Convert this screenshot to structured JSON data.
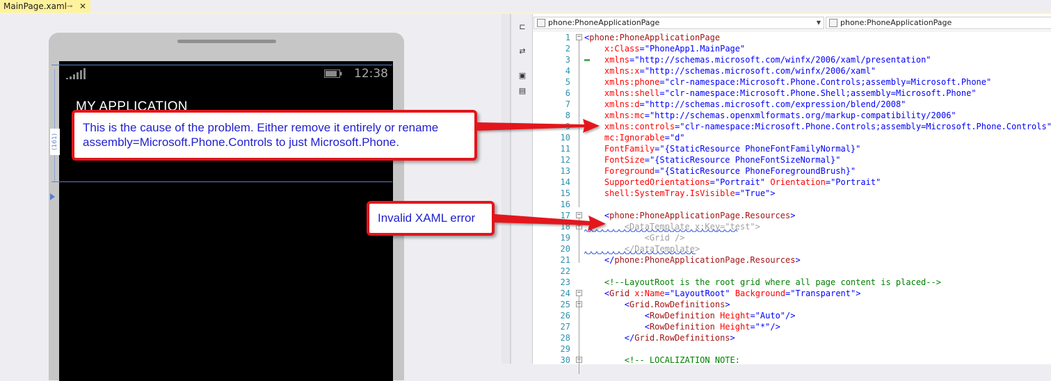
{
  "tab": {
    "title": "MainPage.xaml",
    "pin_icon": "pin-icon",
    "close_glyph": "✕"
  },
  "phone": {
    "status_time": "12:38",
    "app_title": "MY APPLICATION",
    "guide_label": "(161)"
  },
  "editor": {
    "nav_left": "phone:PhoneApplicationPage",
    "nav_right": "phone:PhoneApplicationPage",
    "lines": [
      {
        "n": "1",
        "fold": "minus",
        "html": "<span class='c-bracket'>&lt;</span><span class='c-tag'>phone:PhoneApplicationPage</span>"
      },
      {
        "n": "2",
        "html": "    <span class='c-attr'>x:Class</span><span class='c-bracket'>=</span><span class='c-val'>\"PhoneApp1.MainPage\"</span>"
      },
      {
        "n": "3",
        "html": "    <span class='c-attr'>xmlns</span><span class='c-bracket'>=</span><span class='c-val'>\"http://schemas.microsoft.com/winfx/2006/xaml/presentation\"</span>"
      },
      {
        "n": "4",
        "html": "    <span class='c-attr'>xmlns:x</span><span class='c-bracket'>=</span><span class='c-val'>\"http://schemas.microsoft.com/winfx/2006/xaml\"</span>"
      },
      {
        "n": "5",
        "html": "    <span class='c-attr'>xmlns:phone</span><span class='c-bracket'>=</span><span class='c-val'>\"clr-namespace:Microsoft.Phone.Controls;assembly=Microsoft.Phone\"</span>"
      },
      {
        "n": "6",
        "html": "    <span class='c-attr'>xmlns:shell</span><span class='c-bracket'>=</span><span class='c-val'>\"clr-namespace:Microsoft.Phone.Shell;assembly=Microsoft.Phone\"</span>"
      },
      {
        "n": "7",
        "html": "    <span class='c-attr'>xmlns:d</span><span class='c-bracket'>=</span><span class='c-val'>\"http://schemas.microsoft.com/expression/blend/2008\"</span>"
      },
      {
        "n": "8",
        "html": "    <span class='c-attr'>xmlns:mc</span><span class='c-bracket'>=</span><span class='c-val'>\"http://schemas.openxmlformats.org/markup-compatibility/2006\"</span>"
      },
      {
        "n": "9",
        "html": "    <span class='c-attr'>xmlns:controls</span><span class='c-bracket'>=</span><span class='c-val'>\"clr-namespace:Microsoft.Phone.Controls;assembly=Microsoft.Phone.Controls\"</span>"
      },
      {
        "n": "10",
        "html": "    <span class='c-attr'>mc:Ignorable</span><span class='c-bracket'>=</span><span class='c-val'>\"d\"</span>"
      },
      {
        "n": "11",
        "html": "    <span class='c-attr'>FontFamily</span><span class='c-bracket'>=</span><span class='c-val'>\"{StaticResource PhoneFontFamilyNormal}\"</span>"
      },
      {
        "n": "12",
        "html": "    <span class='c-attr'>FontSize</span><span class='c-bracket'>=</span><span class='c-val'>\"{StaticResource PhoneFontSizeNormal}\"</span>"
      },
      {
        "n": "13",
        "html": "    <span class='c-attr'>Foreground</span><span class='c-bracket'>=</span><span class='c-val'>\"{StaticResource PhoneForegroundBrush}\"</span>"
      },
      {
        "n": "14",
        "html": "    <span class='c-attr'>SupportedOrientations</span><span class='c-bracket'>=</span><span class='c-val'>\"Portrait\"</span> <span class='c-attr'>Orientation</span><span class='c-bracket'>=</span><span class='c-val'>\"Portrait\"</span>"
      },
      {
        "n": "15",
        "html": "    <span class='c-attr'>shell:SystemTray.IsVisible</span><span class='c-bracket'>=</span><span class='c-val'>\"True\"</span><span class='c-bracket'>&gt;</span>"
      },
      {
        "n": "16",
        "html": ""
      },
      {
        "n": "17",
        "fold": "minus",
        "html": "    <span class='c-bracket'>&lt;</span><span class='c-tag'>phone:PhoneApplicationPage.Resources</span><span class='c-bracket'>&gt;</span>"
      },
      {
        "n": "18",
        "fold": "minus",
        "html": "        <span class='c-dim'>&lt;DataTemplate x:Key=\"test\"&gt;</span>"
      },
      {
        "n": "19",
        "html": "            <span class='c-dim'>&lt;Grid /&gt;</span>"
      },
      {
        "n": "20",
        "html": "        <span class='c-dim'>&lt;/DataTemplate&gt;</span>"
      },
      {
        "n": "21",
        "html": "    <span class='c-bracket'>&lt;/</span><span class='c-tag'>phone:PhoneApplicationPage.Resources</span><span class='c-bracket'>&gt;</span>"
      },
      {
        "n": "22",
        "html": ""
      },
      {
        "n": "23",
        "html": "    <span class='c-comment'>&lt;!--LayoutRoot is the root grid where all page content is placed--&gt;</span>"
      },
      {
        "n": "24",
        "fold": "minus",
        "html": "    <span class='c-bracket'>&lt;</span><span class='c-tag'>Grid</span> <span class='c-attr'>x:Name</span><span class='c-bracket'>=</span><span class='c-val'>\"LayoutRoot\"</span> <span class='c-attr'>Background</span><span class='c-bracket'>=</span><span class='c-val'>\"Transparent\"</span><span class='c-bracket'>&gt;</span>"
      },
      {
        "n": "25",
        "fold": "minus",
        "html": "        <span class='c-bracket'>&lt;</span><span class='c-tag'>Grid.RowDefinitions</span><span class='c-bracket'>&gt;</span>"
      },
      {
        "n": "26",
        "html": "            <span class='c-bracket'>&lt;</span><span class='c-tag'>RowDefinition</span> <span class='c-attr'>Height</span><span class='c-bracket'>=</span><span class='c-val'>\"Auto\"</span><span class='c-bracket'>/&gt;</span>"
      },
      {
        "n": "27",
        "html": "            <span class='c-bracket'>&lt;</span><span class='c-tag'>RowDefinition</span> <span class='c-attr'>Height</span><span class='c-bracket'>=</span><span class='c-val'>\"*\"</span><span class='c-bracket'>/&gt;</span>"
      },
      {
        "n": "28",
        "html": "        <span class='c-bracket'>&lt;/</span><span class='c-tag'>Grid.RowDefinitions</span><span class='c-bracket'>&gt;</span>"
      },
      {
        "n": "29",
        "html": ""
      },
      {
        "n": "30",
        "fold": "minus",
        "html": "        <span class='c-comment'>&lt;!-- LOCALIZATION NOTE:</span>"
      }
    ]
  },
  "callouts": {
    "cause": "This is the cause of the problem. Either remove it entirely or rename assembly=Microsoft.Phone.Controls to just Microsoft.Phone.",
    "error": "Invalid XAML error"
  },
  "colors": {
    "callout_border": "#e3151a",
    "callout_text": "#1f1fd1",
    "tab_active": "#fff29d"
  }
}
